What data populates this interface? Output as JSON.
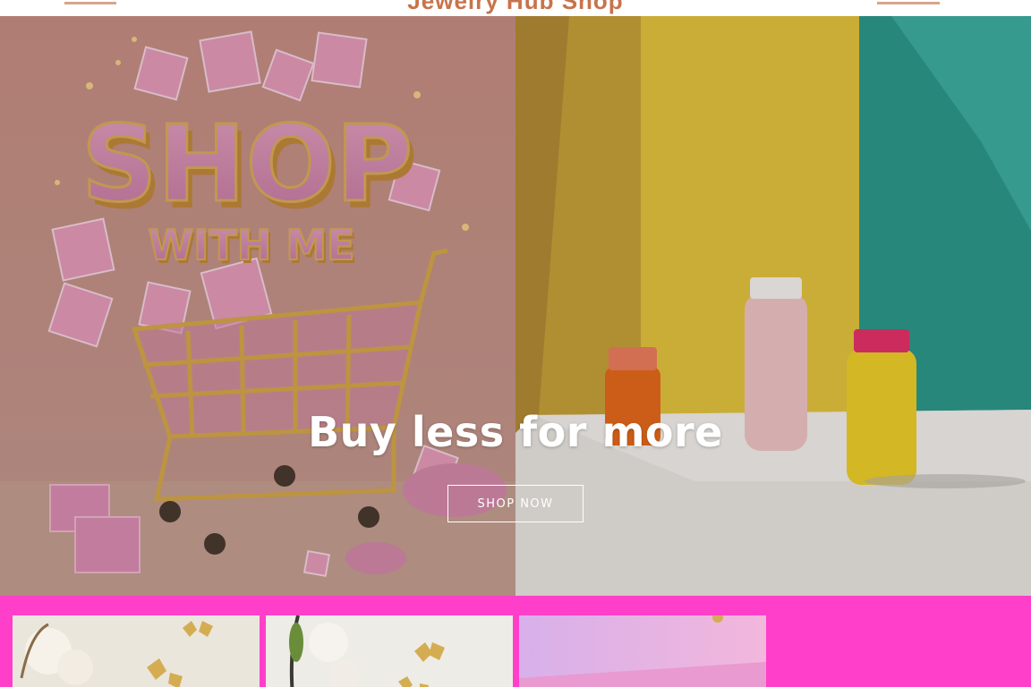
{
  "header": {
    "brand": "Jewelry Hub Shop"
  },
  "hero": {
    "left_image": {
      "alt": "Shop with me",
      "art_text_line1": "SHOP",
      "art_text_line2": "WITH ME"
    },
    "right_image": {
      "alt": "Product bottles on shelf"
    },
    "heading": "Buy less for more",
    "cta_label": "SHOP NOW"
  },
  "products": {
    "background": "#ff3fc9",
    "items": [
      {
        "alt": "Gold butterfly wall decor 1"
      },
      {
        "alt": "Gold butterfly wall decor 2"
      },
      {
        "alt": "Pastel product"
      }
    ]
  },
  "colors": {
    "brand": "#c8734a",
    "accent": "#ff3fc9"
  }
}
